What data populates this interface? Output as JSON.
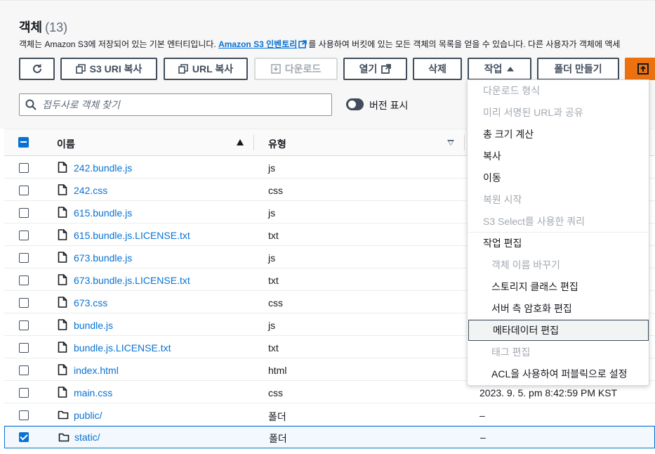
{
  "header": {
    "title": "객체",
    "count": "(13)",
    "description_pre": "객체는 Amazon S3에 저장되어 있는 기본 엔터티입니다. ",
    "inventory_link": "Amazon S3 인벤토리",
    "description_post": "를 사용하여 버킷에 있는 모든 객체의 목록을 얻을 수 있습니다. 다른 사용자가 객체에 액세"
  },
  "toolbar": {
    "refresh": "",
    "copy_s3_uri": "S3 URI 복사",
    "copy_url": "URL 복사",
    "download": "다운로드",
    "open": "열기",
    "delete": "삭제",
    "actions": "작업",
    "create_folder": "폴더 만들기",
    "upload": ""
  },
  "search": {
    "placeholder": "접두사로 객체 찾기"
  },
  "versions_toggle": {
    "label": "버전 표시"
  },
  "table": {
    "columns": [
      "이름",
      "유형"
    ],
    "rows": [
      {
        "name": "242.bundle.js",
        "type": "js",
        "kind": "file",
        "date": "",
        "checked": false
      },
      {
        "name": "242.css",
        "type": "css",
        "kind": "file",
        "date": "",
        "checked": false
      },
      {
        "name": "615.bundle.js",
        "type": "js",
        "kind": "file",
        "date": "",
        "checked": false
      },
      {
        "name": "615.bundle.js.LICENSE.txt",
        "type": "txt",
        "kind": "file",
        "date": "",
        "checked": false
      },
      {
        "name": "673.bundle.js",
        "type": "js",
        "kind": "file",
        "date": "",
        "checked": false
      },
      {
        "name": "673.bundle.js.LICENSE.txt",
        "type": "txt",
        "kind": "file",
        "date": "",
        "checked": false
      },
      {
        "name": "673.css",
        "type": "css",
        "kind": "file",
        "date": "",
        "checked": false
      },
      {
        "name": "bundle.js",
        "type": "js",
        "kind": "file",
        "date": "",
        "checked": false
      },
      {
        "name": "bundle.js.LICENSE.txt",
        "type": "txt",
        "kind": "file",
        "date": "",
        "checked": false
      },
      {
        "name": "index.html",
        "type": "html",
        "kind": "file",
        "date": "",
        "checked": false
      },
      {
        "name": "main.css",
        "type": "css",
        "kind": "file",
        "date": "2023. 9. 5. pm 8:42:59 PM KST",
        "checked": false
      },
      {
        "name": "public/",
        "type": "폴더",
        "kind": "folder",
        "date": "–",
        "checked": false
      },
      {
        "name": "static/",
        "type": "폴더",
        "kind": "folder",
        "date": "–",
        "checked": true
      }
    ]
  },
  "actions_menu": {
    "items": [
      {
        "label": "다운로드 형식",
        "state": "disabled"
      },
      {
        "label": "미리 서명된 URL과 공유",
        "state": "disabled"
      },
      {
        "label": "총 크기 계산",
        "state": "enabled"
      },
      {
        "label": "복사",
        "state": "enabled"
      },
      {
        "label": "이동",
        "state": "enabled"
      },
      {
        "label": "복원 시작",
        "state": "disabled"
      },
      {
        "label": "S3 Select를 사용한 쿼리",
        "state": "disabled"
      },
      {
        "label": "작업 편집",
        "state": "group"
      },
      {
        "label": "객체 이름 바꾸기",
        "state": "disabled"
      },
      {
        "label": "스토리지 클래스 편집",
        "state": "enabled"
      },
      {
        "label": "서버 측 암호화 편집",
        "state": "enabled"
      },
      {
        "label": "메타데이터 편집",
        "state": "hover"
      },
      {
        "label": "태그 편집",
        "state": "disabled"
      },
      {
        "label": "ACL을 사용하여 퍼블릭으로 설정",
        "state": "enabled"
      }
    ]
  },
  "colors": {
    "link": "#0972d3",
    "primary": "#ec7211",
    "border": "#414d5c",
    "disabled": "#a2a9b1"
  }
}
